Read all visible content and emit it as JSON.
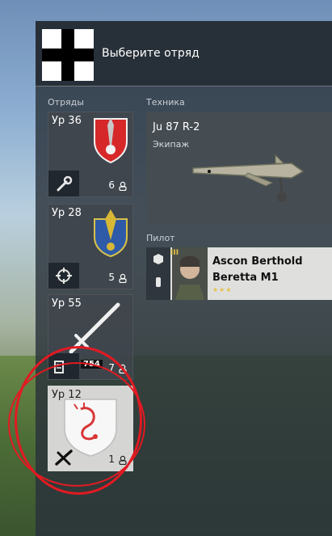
{
  "header": {
    "title": "Выберите отряд"
  },
  "sections": {
    "squads_label": "Отряды",
    "vehicle_label": "Техника",
    "pilot_label": "Пилот"
  },
  "squads": [
    {
      "level": "Ур 36",
      "count": "6",
      "role_icon": "wrench-icon",
      "emblem": "trieste-shield"
    },
    {
      "level": "Ур 28",
      "count": "5",
      "role_icon": "crosshair-icon",
      "emblem": "pistoia-shield"
    },
    {
      "level": "Ур 55",
      "count": "7",
      "role_icon": "ammo-icon",
      "role_value": "754",
      "emblem": "sword"
    },
    {
      "level": "Ур 12",
      "count": "1",
      "role_icon": "plane-icon",
      "emblem": "scorpion-shield",
      "selected": true
    }
  ],
  "vehicle": {
    "name": "Ju 87 R-2",
    "subtitle": "Экипаж"
  },
  "pilot": {
    "name_line1": "Ascon Berthold",
    "name_line2": "Beretta M1",
    "rank": "III",
    "stars": "★★★"
  },
  "colors": {
    "highlight": "#e21a22",
    "panel": "#2a323a",
    "selected": "#dcdcda",
    "gold": "#e6c04a"
  }
}
